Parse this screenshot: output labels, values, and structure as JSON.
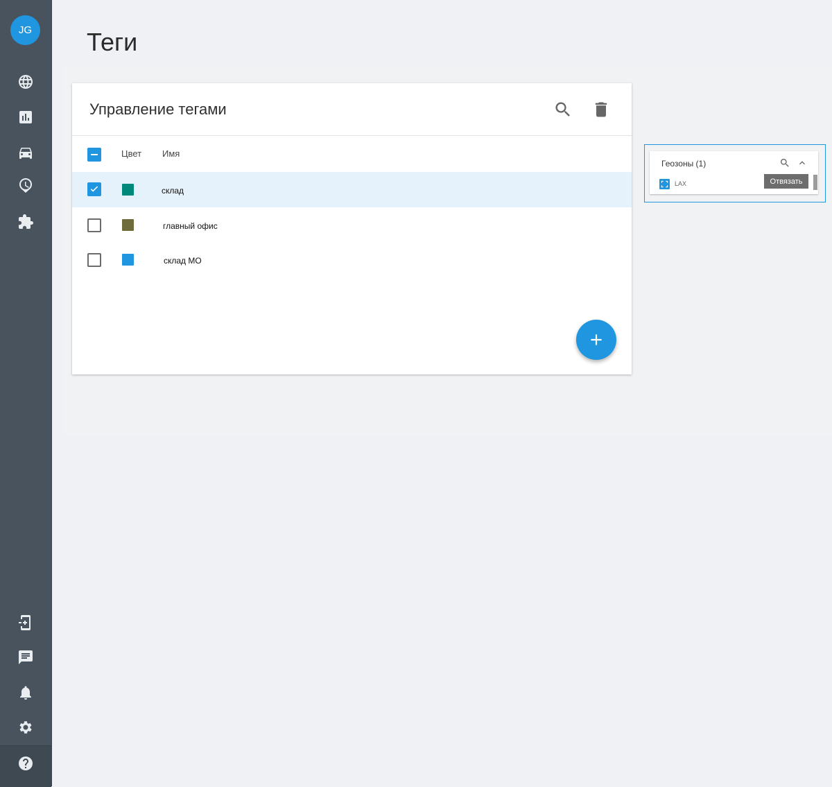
{
  "user": {
    "initials": "JG"
  },
  "page": {
    "title": "Теги"
  },
  "card": {
    "title": "Управление тегами",
    "columns": {
      "color": "Цвет",
      "name": "Имя"
    },
    "rows": [
      {
        "name": "склад",
        "color": "#00897b",
        "checked": true
      },
      {
        "name": "главный офис",
        "color": "#6f6c3b",
        "checked": false
      },
      {
        "name": "склад МО",
        "color": "#2196e0",
        "checked": false
      }
    ]
  },
  "geozones": {
    "title": "Геозоны (1)",
    "items": [
      {
        "label": "LAX"
      }
    ],
    "tooltip": "Отвязать"
  },
  "colors": {
    "accent": "#2196e0",
    "sidebar": "#48535e"
  },
  "icons": {
    "nav_top": [
      "globe-icon",
      "bar-chart-icon",
      "car-icon",
      "geofence-clock-icon",
      "puzzle-icon"
    ],
    "nav_bottom": [
      "add-device-icon",
      "chat-icon",
      "bell-icon",
      "gear-icon",
      "help-icon"
    ]
  }
}
